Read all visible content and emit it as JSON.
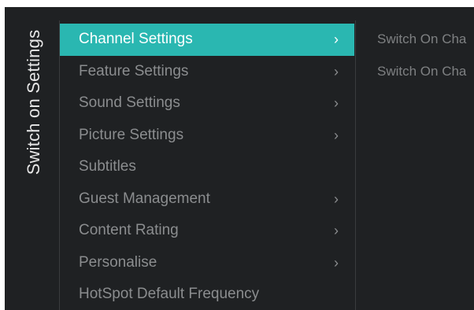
{
  "panel": {
    "title": "Switch on Settings"
  },
  "menu": {
    "items": [
      {
        "label": "Channel Settings",
        "arrow": "›",
        "selected": true
      },
      {
        "label": "Feature Settings",
        "arrow": "›"
      },
      {
        "label": "Sound Settings",
        "arrow": "›"
      },
      {
        "label": "Picture Settings",
        "arrow": "›"
      },
      {
        "label": "Subtitles",
        "arrow": ""
      },
      {
        "label": "Guest Management",
        "arrow": "›"
      },
      {
        "label": "Content Rating",
        "arrow": "›"
      },
      {
        "label": "Personalise",
        "arrow": "›"
      },
      {
        "label": "HotSpot Default Frequency",
        "arrow": ""
      }
    ]
  },
  "submenu": {
    "items": [
      {
        "label": "Switch On Cha"
      },
      {
        "label": "Switch On Cha"
      }
    ]
  },
  "colors": {
    "background": "#1f2123",
    "accent": "#2ab7b1",
    "text_dim": "#8b8d8f",
    "text_bright": "#ffffff"
  }
}
